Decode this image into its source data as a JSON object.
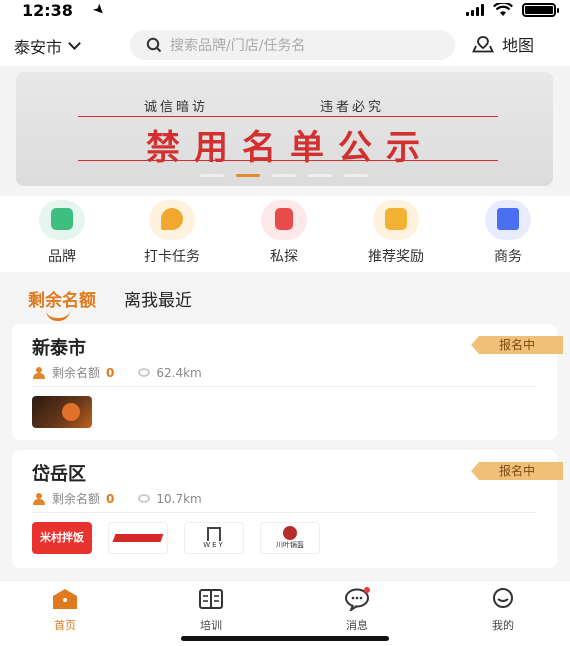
{
  "status": {
    "time": "12:38"
  },
  "header": {
    "city": "泰安市",
    "search_placeholder": "搜索品牌/门店/任务名",
    "map_label": "地图"
  },
  "banner": {
    "sub_left": "诚信暗访",
    "sub_right": "违者必究",
    "title": "禁用名单公示",
    "dots": 5,
    "active_dot": 1
  },
  "categories": [
    {
      "label": "品牌",
      "icon": "brand-icon",
      "bg": "#e6f6ee",
      "fg": "#3fbf7f"
    },
    {
      "label": "打卡任务",
      "icon": "checkin-icon",
      "bg": "#fff3df",
      "fg": "#f0a830"
    },
    {
      "label": "私探",
      "icon": "private-visit-icon",
      "bg": "#fde8e8",
      "fg": "#e94a4a"
    },
    {
      "label": "推荐奖励",
      "icon": "reward-icon",
      "bg": "#fff3df",
      "fg": "#f2b233"
    },
    {
      "label": "商务",
      "icon": "business-icon",
      "bg": "#e8ecfc",
      "fg": "#4a6ff0"
    }
  ],
  "tabs": [
    {
      "label": "剩余名额",
      "active": true
    },
    {
      "label": "离我最近",
      "active": false
    }
  ],
  "cards": [
    {
      "title": "新泰市",
      "badge": "报名中",
      "remaining_label": "剩余名额",
      "remaining_count": "0",
      "distance": "62.4km",
      "logos": [
        "restaurant-logo"
      ]
    },
    {
      "title": "岱岳区",
      "badge": "报名中",
      "remaining_label": "剩余名额",
      "remaining_count": "0",
      "distance": "10.7km",
      "logos": [
        "米村拌饭",
        "red-stripe-logo",
        "WEY",
        "川叶锅盔"
      ]
    }
  ],
  "nav": [
    {
      "label": "首页",
      "icon": "home-icon",
      "active": true
    },
    {
      "label": "培训",
      "icon": "book-icon",
      "active": false
    },
    {
      "label": "消息",
      "icon": "message-icon",
      "active": false,
      "badge": true
    },
    {
      "label": "我的",
      "icon": "profile-icon",
      "active": false
    }
  ],
  "colors": {
    "accent": "#e07a1f",
    "banner_red": "#d32f2f",
    "badge_bg": "#f0c078"
  }
}
